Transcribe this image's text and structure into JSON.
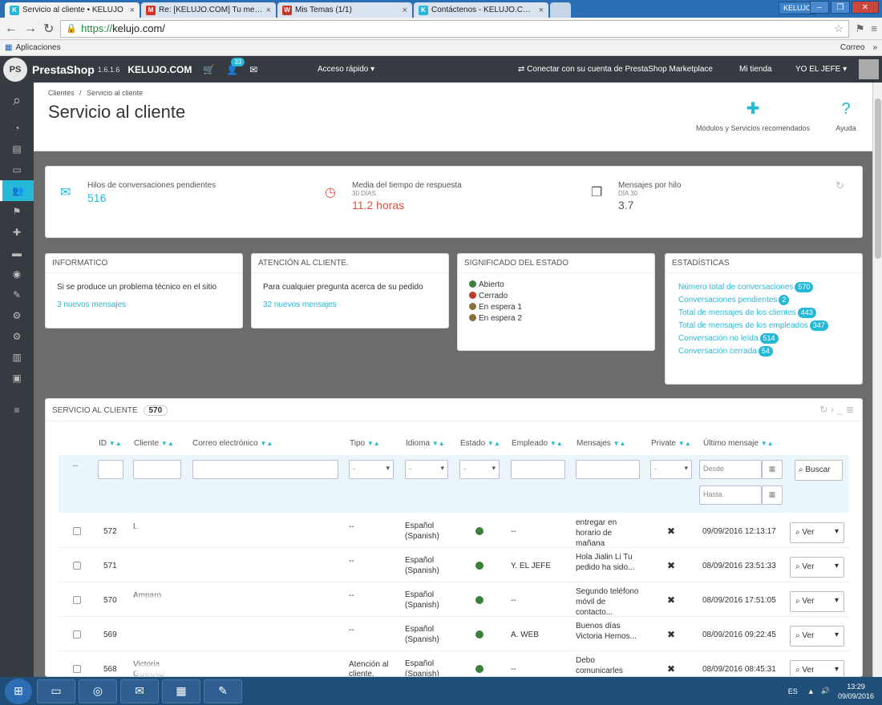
{
  "browser": {
    "tabs": [
      {
        "title": "Servicio al cliente • KELUJO",
        "active": true
      },
      {
        "title": "Re: [KELUJO.COM] Tu mensaje",
        "active": false
      },
      {
        "title": "Mis Temas (1/1)",
        "active": false
      },
      {
        "title": "Contáctenos - KELUJO.COM",
        "active": false
      }
    ],
    "window_user": "KELUJO",
    "url_scheme": "https://",
    "url_rest": "kelujo.com/",
    "bookmark_apps": "Aplicaciones",
    "bookmark_more": "»",
    "bookmark_last": "Correo"
  },
  "ps": {
    "brand": "PrestaShop",
    "version": "1.6.1.6",
    "shop": "KELUJO.COM",
    "notif_count": "33",
    "quick_access": "Acceso rápido",
    "marketplace": "Conectar con su cuenta de PrestaShop Marketplace",
    "my_shop": "Mi tienda",
    "user": "YO EL JEFE"
  },
  "page": {
    "breadcrumb_1": "Clientes",
    "breadcrumb_sep": "/",
    "breadcrumb_2": "Servicio al cliente",
    "title": "Servicio al cliente",
    "btn_modules": "Módulos y Servicios recomendados",
    "btn_help": "Ayuda"
  },
  "kpi": [
    {
      "label": "Hilos de conversaciones pendientes",
      "sub": "",
      "value": "516",
      "color": "#25b9d7"
    },
    {
      "label": "Media del tiempo de respuesta",
      "sub": "30 DÍAS",
      "value": "11.2 horas",
      "color": "#e74c3c"
    },
    {
      "label": "Mensajes por hilo",
      "sub": "DÍA 30",
      "value": "3.7",
      "color": "#555555"
    }
  ],
  "panels": {
    "informatico": {
      "title": "Informatico",
      "text": "Si se produce un problema técnico en el sitio",
      "link": "3 nuevos mensajes"
    },
    "atencion": {
      "title": "Atención al cliente.",
      "text": "Para cualquier pregunta acerca de su pedido",
      "link": "32 nuevos mensajes"
    },
    "estado": {
      "title": "Significado del estado",
      "items": [
        "Abierto",
        "Cerrado",
        "En espera 1",
        "En espera 2"
      ]
    },
    "stats": {
      "title": "Estadísticas",
      "items": [
        {
          "label": "Número total de conversaciones",
          "value": "570"
        },
        {
          "label": "Conversaciones pendientes",
          "value": "2"
        },
        {
          "label": "Total de mensajes de los clientes",
          "value": "443"
        },
        {
          "label": "Total de mensajes de los empleados",
          "value": "347"
        },
        {
          "label": "Conversación no leída",
          "value": "514"
        },
        {
          "label": "Conversación cerrada",
          "value": "54"
        }
      ]
    }
  },
  "table": {
    "title": "Servicio al cliente",
    "count": "570",
    "headers": [
      "ID",
      "Cliente",
      "Correo electrónico",
      "Tipo",
      "Idioma",
      "Estado",
      "Empleado",
      "Mensajes",
      "Private",
      "Último mensaje"
    ],
    "filter_dash": "--",
    "filter_select": "-",
    "date_from": "Desde",
    "date_to": "Hasta",
    "search_btn": "Buscar",
    "view_btn": "Ver",
    "rows": [
      {
        "id": "572",
        "client": "L",
        "tipo": "--",
        "idioma": "Español (Spanish)",
        "empleado": "--",
        "mensaje": "entregar en horario de mañana",
        "fecha": "09/09/2016 12:13:17"
      },
      {
        "id": "571",
        "client": "",
        "tipo": "--",
        "idioma": "Español (Spanish)",
        "empleado": "Y. EL JEFE",
        "mensaje": "Hola Jialin Li Tu pedido ha sido...",
        "fecha": "08/09/2016 23:51:33"
      },
      {
        "id": "570",
        "client": "Amparo",
        "tipo": "--",
        "idioma": "Español (Spanish)",
        "empleado": "--",
        "mensaje": "Segundo teléfono móvil de contacto...",
        "fecha": "08/09/2016 17:51:05"
      },
      {
        "id": "569",
        "client": "",
        "tipo": "--",
        "idioma": "Español (Spanish)",
        "empleado": "A. WEB",
        "mensaje": "Buenos días Victoria Hemos...",
        "fecha": "08/09/2016 09:22:45"
      },
      {
        "id": "568",
        "client": "Victoria GUIRAO",
        "tipo": "Atención al cliente.",
        "idioma": "Español (Spanish)",
        "empleado": "--",
        "mensaje": "Debo comunicarles",
        "fecha": "08/09/2016 08:45:31"
      }
    ]
  },
  "taskbar": {
    "lang": "ES",
    "time": "13:29",
    "date": "09/09/2016"
  }
}
